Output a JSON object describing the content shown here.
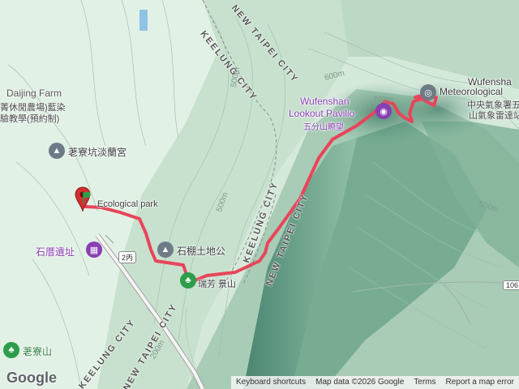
{
  "map": {
    "labels": {
      "farm_en": "Daijing Farm",
      "farm_cn1": "菁休閒農場)藍染",
      "farm_cn2": "驗教學(預約制)",
      "temple1": "荖寮坑淡蘭宮",
      "park": "Ecological park",
      "stone_ruin": "石厝遺址",
      "temple2": "石棚土地公",
      "lookout_en1": "Wufenshan",
      "lookout_en2": "Lookout Pavilio",
      "lookout_cn": "五分山瞭望",
      "meteo_en1": "Wufensha",
      "meteo_en2": "Meteorological",
      "meteo_cn1": "中央氣象署五",
      "meteo_cn2": "山氣象雷達站",
      "mountain1": "荖寮山",
      "mountain2": "瑞芳 景山",
      "city_keelung_top": "KEELUNG CITY",
      "city_newtaipei_top": "NEW TAIPEI CITY",
      "city_keelung_mid": "KEELUNG CITY",
      "city_newtaipei_mid": "NEW TAIPEI CITY",
      "city_keelung_bot": "KEELUNG CITY",
      "city_newtaipei_bot": "NEW TAIPEI CITY",
      "road_2bing": "2丙",
      "road_106": "106",
      "contour_500a": "500m",
      "contour_500b": "500m",
      "contour_500c": "500m",
      "contour_600": "600m",
      "contour_700": "700m",
      "contour_200": "200m"
    },
    "colors": {
      "route": "#e8455a",
      "terrain_light": "#d7ebdd",
      "terrain_dark": "#4f8a76",
      "attraction": "#8a3fb3",
      "marker_start": "#d32f2f",
      "marker_green": "#2e9d4b"
    },
    "icons": {
      "start_marker": "map-pin-icon",
      "temple": "temple-icon",
      "museum": "museum-icon",
      "camera": "camera-icon",
      "weather": "weather-station-icon",
      "park": "park-icon"
    }
  },
  "logo": "Google",
  "attribution": {
    "shortcuts": "Keyboard shortcuts",
    "mapdata": "Map data ©2026 Google",
    "terms": "Terms",
    "report": "Report a map error"
  }
}
